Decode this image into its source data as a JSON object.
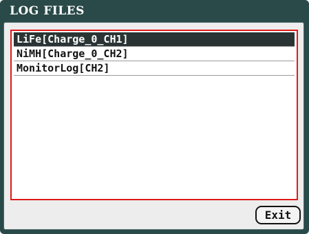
{
  "window": {
    "title": "LOG FILES"
  },
  "log_list": {
    "items": [
      {
        "label": "LiFe[Charge_0_CH1]",
        "selected": true
      },
      {
        "label": "NiMH[Charge_0_CH2]",
        "selected": false
      },
      {
        "label": "MonitorLog[CH2]",
        "selected": false
      }
    ]
  },
  "buttons": {
    "exit_label": "Exit"
  },
  "colors": {
    "frame": "#2a4a49",
    "selection": "#2a3434",
    "list_border": "#e01818"
  }
}
